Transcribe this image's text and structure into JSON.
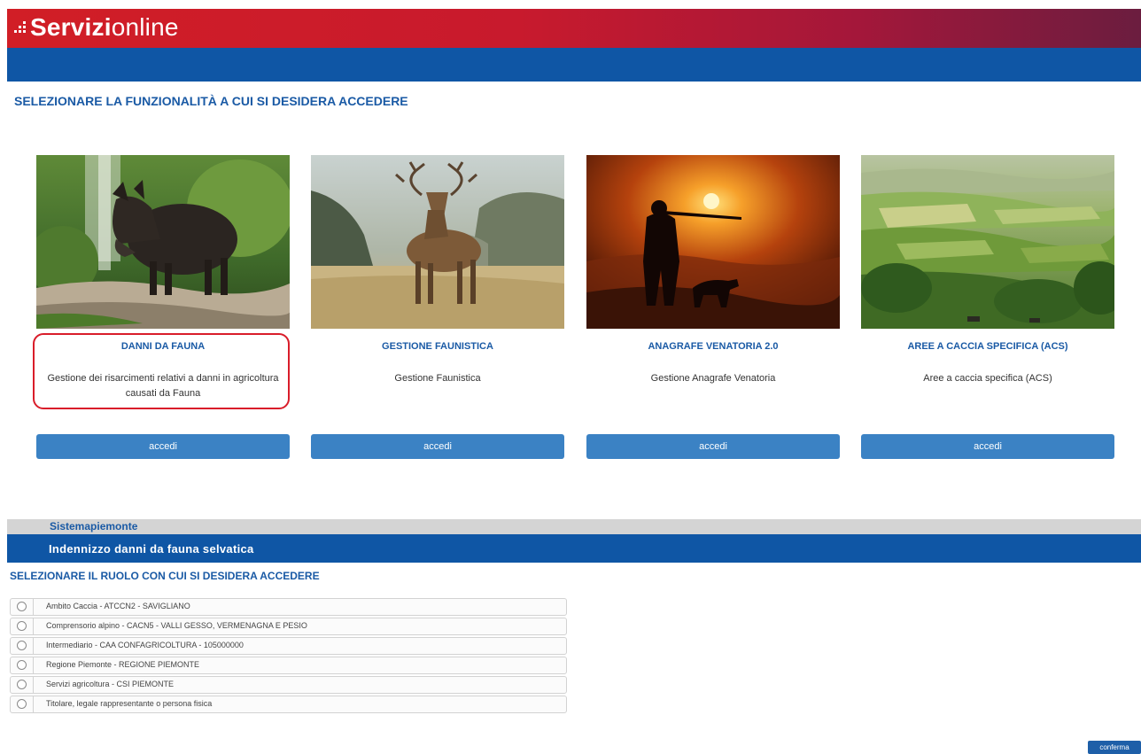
{
  "header": {
    "brand_bold": "Servizi",
    "brand_light": "online"
  },
  "main": {
    "select_title": "SELEZIONARE LA FUNZIONALITÀ A CUI SI DESIDERA ACCEDERE",
    "cards": [
      {
        "title": "DANNI DA FAUNA",
        "desc_line1": "Gestione dei risarcimenti relativi a danni in agricoltura",
        "desc_line2": "causati da Fauna",
        "button": "accedi",
        "image": "wild-boar-photo"
      },
      {
        "title": "GESTIONE FAUNISTICA",
        "desc_line1": "Gestione Faunistica",
        "desc_line2": "",
        "button": "accedi",
        "image": "deer-photo"
      },
      {
        "title": "ANAGRAFE VENATORIA 2.0",
        "desc_line1": "Gestione Anagrafe Venatoria",
        "desc_line2": "",
        "button": "accedi",
        "image": "hunter-sunset-photo"
      },
      {
        "title": "AREE A CACCIA SPECIFICA (ACS)",
        "desc_line1": "Aree a caccia specifica (ACS)",
        "desc_line2": "",
        "button": "accedi",
        "image": "countryside-photo"
      }
    ]
  },
  "role_panel": {
    "sistema_label": "Sistemapiemonte",
    "service_title": "Indennizzo danni da fauna selvatica",
    "role_title": "SELEZIONARE IL RUOLO CON CUI SI DESIDERA ACCEDERE",
    "roles": [
      "Ambito Caccia - ATCCN2 - SAVIGLIANO",
      "Comprensorio alpino - CACN5 - VALLI GESSO, VERMENAGNA E PESIO",
      "Intermediario - CAA CONFAGRICOLTURA -  105000000",
      "Regione Piemonte - REGIONE PIEMONTE",
      "Servizi agricoltura - CSI PIEMONTE",
      "Titolare, legale rappresentante o persona fisica"
    ],
    "confirm_label": "conferma"
  },
  "colors": {
    "brand_red": "#d11e26",
    "brand_blue": "#0f56a5",
    "title_blue": "#1a5aa5",
    "button_blue": "#3b82c4",
    "highlight_red": "#d91d2a"
  }
}
